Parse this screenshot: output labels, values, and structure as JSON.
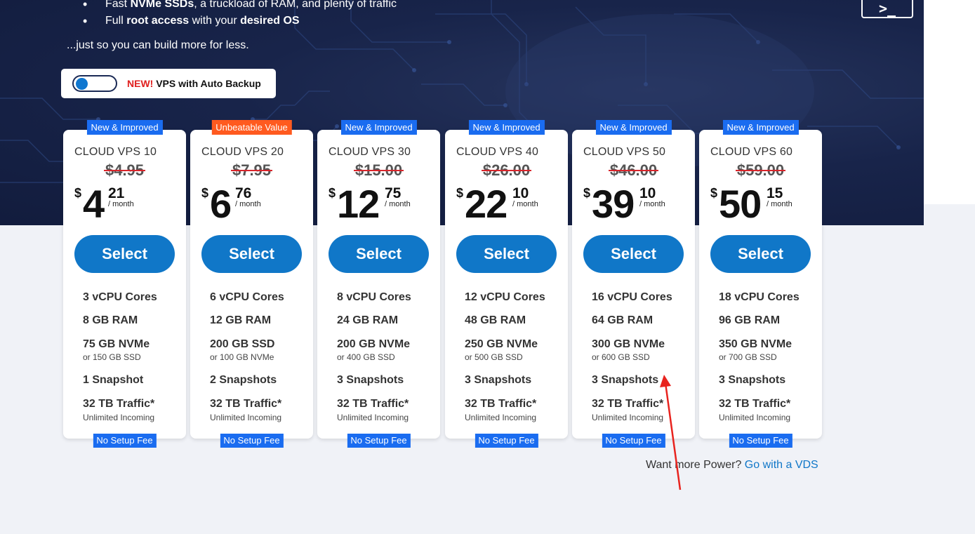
{
  "hero": {
    "bullets": [
      {
        "pre": "Fast ",
        "bold1": "NVMe SSDs",
        "mid": ", a truckload of RAM, and plenty of traffic",
        "bold2": "",
        "post": ""
      },
      {
        "pre": "Full ",
        "bold1": "root access",
        "mid": " with your ",
        "bold2": "desired OS",
        "post": ""
      }
    ],
    "tagline": "...just so you can build more for less.",
    "terminal_label": ">_",
    "backup_toggle": {
      "new_label": "NEW!",
      "label": " VPS with Auto Backup",
      "state": "off"
    }
  },
  "plans": [
    {
      "badge": "New & Improved",
      "badge_color": "#1a6cf0",
      "name": "CLOUD VPS 10",
      "old_price": "$4.95",
      "currency": "$",
      "price_int": "4",
      "price_cents": "21",
      "per": "/ month",
      "select": "Select",
      "cpu": "3 vCPU Cores",
      "ram": "8 GB RAM",
      "storage": "75 GB NVMe",
      "storage_alt": "or 150 GB SSD",
      "snapshots": "1 Snapshot",
      "traffic": "32 TB Traffic*",
      "traffic_note": "Unlimited Incoming",
      "footer_badge": "No Setup Fee"
    },
    {
      "badge": "Unbeatable Value",
      "badge_color": "#ff5a1f",
      "name": "CLOUD VPS 20",
      "old_price": "$7.95",
      "currency": "$",
      "price_int": "6",
      "price_cents": "76",
      "per": "/ month",
      "select": "Select",
      "cpu": "6 vCPU Cores",
      "ram": "12 GB RAM",
      "storage": "200 GB SSD",
      "storage_alt": "or 100 GB NVMe",
      "snapshots": "2 Snapshots",
      "traffic": "32 TB Traffic*",
      "traffic_note": "Unlimited Incoming",
      "footer_badge": "No Setup Fee"
    },
    {
      "badge": "New & Improved",
      "badge_color": "#1a6cf0",
      "name": "CLOUD VPS 30",
      "old_price": "$15.00",
      "currency": "$",
      "price_int": "12",
      "price_cents": "75",
      "per": "/ month",
      "select": "Select",
      "cpu": "8 vCPU Cores",
      "ram": "24 GB RAM",
      "storage": "200 GB NVMe",
      "storage_alt": "or 400 GB SSD",
      "snapshots": "3 Snapshots",
      "traffic": "32 TB Traffic*",
      "traffic_note": "Unlimited Incoming",
      "footer_badge": "No Setup Fee"
    },
    {
      "badge": "New & Improved",
      "badge_color": "#1a6cf0",
      "name": "CLOUD VPS 40",
      "old_price": "$26.00",
      "currency": "$",
      "price_int": "22",
      "price_cents": "10",
      "per": "/ month",
      "select": "Select",
      "cpu": "12 vCPU Cores",
      "ram": "48 GB RAM",
      "storage": "250 GB NVMe",
      "storage_alt": "or 500 GB SSD",
      "snapshots": "3 Snapshots",
      "traffic": "32 TB Traffic*",
      "traffic_note": "Unlimited Incoming",
      "footer_badge": "No Setup Fee"
    },
    {
      "badge": "New & Improved",
      "badge_color": "#1a6cf0",
      "name": "CLOUD VPS 50",
      "old_price": "$46.00",
      "currency": "$",
      "price_int": "39",
      "price_cents": "10",
      "per": "/ month",
      "select": "Select",
      "cpu": "16 vCPU Cores",
      "ram": "64 GB RAM",
      "storage": "300 GB NVMe",
      "storage_alt": "or 600 GB SSD",
      "snapshots": "3 Snapshots",
      "traffic": "32 TB Traffic*",
      "traffic_note": "Unlimited Incoming",
      "footer_badge": "No Setup Fee"
    },
    {
      "badge": "New & Improved",
      "badge_color": "#1a6cf0",
      "name": "CLOUD VPS 60",
      "old_price": "$59.00",
      "currency": "$",
      "price_int": "50",
      "price_cents": "15",
      "per": "/ month",
      "select": "Select",
      "cpu": "18 vCPU Cores",
      "ram": "96 GB RAM",
      "storage": "350 GB NVMe",
      "storage_alt": "or 700 GB SSD",
      "snapshots": "3 Snapshots",
      "traffic": "32 TB Traffic*",
      "traffic_note": "Unlimited Incoming",
      "footer_badge": "No Setup Fee"
    }
  ],
  "more_power": {
    "text": "Want more Power? ",
    "link": "Go with a VDS"
  },
  "colors": {
    "hero_bg": "#18244a",
    "accent_blue": "#1077c8",
    "badge_blue": "#1a6cf0",
    "badge_orange": "#ff5a1f",
    "strike_red": "#d8252b",
    "annotation_red": "#e8231e"
  },
  "annotation": {
    "type": "red-arrow"
  }
}
